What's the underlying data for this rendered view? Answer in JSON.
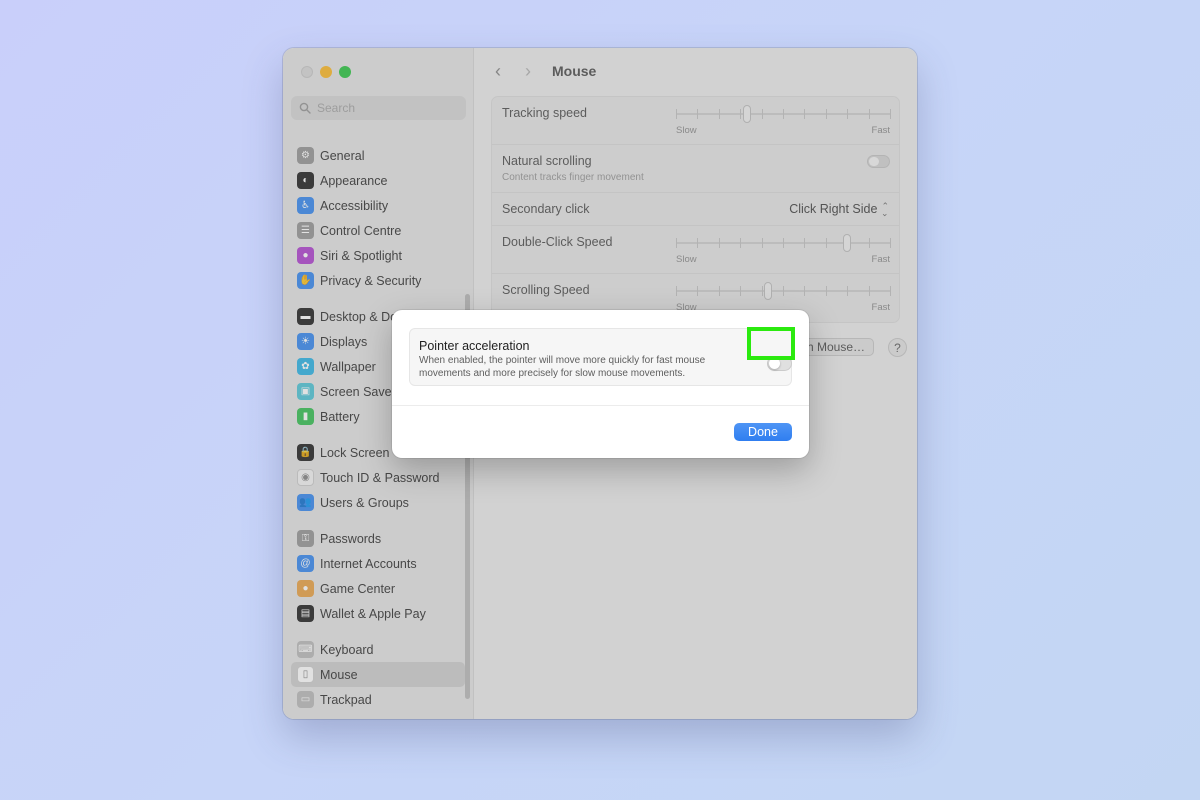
{
  "window": {
    "title": "Mouse",
    "search": {
      "placeholder": "Search",
      "value": ""
    }
  },
  "sidebar": {
    "groups": [
      [
        {
          "label": "General",
          "icon": "gear-icon",
          "color": "#9a9a9a"
        },
        {
          "label": "Appearance",
          "icon": "appearance-icon",
          "color": "#2b2b2b"
        },
        {
          "label": "Accessibility",
          "icon": "accessibility-icon",
          "color": "#3f8ef0"
        },
        {
          "label": "Control Centre",
          "icon": "control-centre-icon",
          "color": "#9a9a9a"
        },
        {
          "label": "Siri & Spotlight",
          "icon": "siri-icon",
          "color": "#b24bd1"
        },
        {
          "label": "Privacy & Security",
          "icon": "hand-icon",
          "color": "#3f8ef0"
        }
      ],
      [
        {
          "label": "Desktop & Dock",
          "icon": "dock-icon",
          "color": "#2b2b2b"
        },
        {
          "label": "Displays",
          "icon": "sun-icon",
          "color": "#3f8ef0"
        },
        {
          "label": "Wallpaper",
          "icon": "flower-icon",
          "color": "#37b7e6"
        },
        {
          "label": "Screen Saver",
          "icon": "screen-saver-icon",
          "color": "#57c7d8"
        },
        {
          "label": "Battery",
          "icon": "battery-icon",
          "color": "#3ec25a"
        }
      ],
      [
        {
          "label": "Lock Screen",
          "icon": "lock-icon",
          "color": "#2b2b2b"
        },
        {
          "label": "Touch ID & Password",
          "icon": "fingerprint-icon",
          "color": "#f4f4f4"
        },
        {
          "label": "Users & Groups",
          "icon": "users-icon",
          "color": "#3f8ef0"
        }
      ],
      [
        {
          "label": "Passwords",
          "icon": "key-icon",
          "color": "#9a9a9a"
        },
        {
          "label": "Internet Accounts",
          "icon": "at-icon",
          "color": "#3f8ef0"
        },
        {
          "label": "Game Center",
          "icon": "game-center-icon",
          "color": "#e9a64d"
        },
        {
          "label": "Wallet & Apple Pay",
          "icon": "wallet-icon",
          "color": "#2b2b2b"
        }
      ],
      [
        {
          "label": "Keyboard",
          "icon": "keyboard-icon",
          "color": "#bdbdbd"
        },
        {
          "label": "Mouse",
          "icon": "mouse-icon",
          "color": "#ffffff",
          "selected": true
        },
        {
          "label": "Trackpad",
          "icon": "trackpad-icon",
          "color": "#bdbdbd"
        }
      ]
    ]
  },
  "settings": {
    "tracking_speed": {
      "label": "Tracking speed",
      "min_label": "Slow",
      "max_label": "Fast",
      "value": 0.33
    },
    "natural_scrolling": {
      "label": "Natural scrolling",
      "description": "Content tracks finger movement",
      "enabled": false
    },
    "secondary_click": {
      "label": "Secondary click",
      "value": "Click Right Side"
    },
    "double_click_speed": {
      "label": "Double-Click Speed",
      "min_label": "Slow",
      "max_label": "Fast",
      "value": 0.8
    },
    "scrolling_speed": {
      "label": "Scrolling Speed",
      "min_label": "Slow",
      "max_label": "Fast",
      "value": 0.43
    },
    "setup_button": "Set Up Bluetooth Mouse…",
    "help_button": "?"
  },
  "dialog": {
    "title": "Pointer acceleration",
    "description": "When enabled, the pointer will move more quickly for fast mouse movements and more precisely for slow mouse movements.",
    "enabled": false,
    "done_label": "Done",
    "highlight_color": "#2bea0f"
  }
}
